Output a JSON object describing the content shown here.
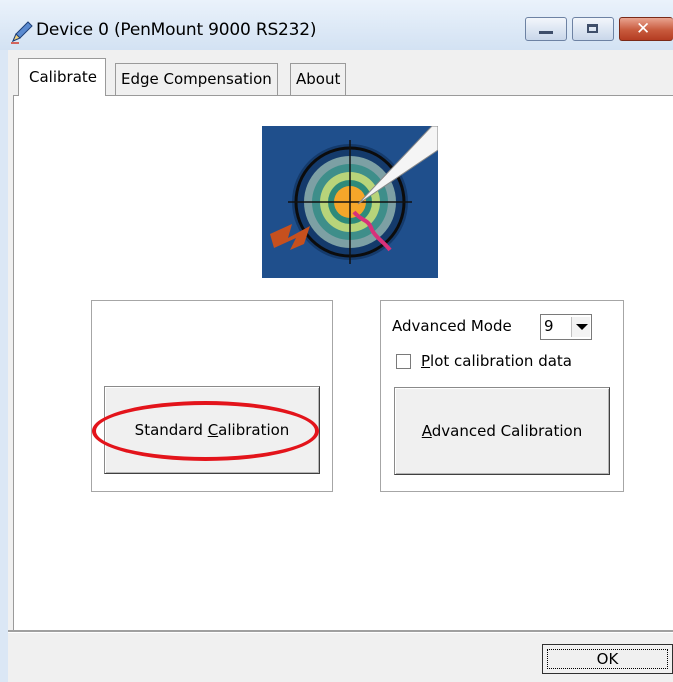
{
  "window": {
    "title": "Device 0 (PenMount 9000 RS232)",
    "close_glyph": "✕",
    "controls": [
      "minimize-icon",
      "maximize-icon",
      "close-icon"
    ]
  },
  "tabs": [
    {
      "label": "Calibrate",
      "selected": true
    },
    {
      "label": "Edge Compensation",
      "selected": false
    },
    {
      "label": "About",
      "selected": false
    }
  ],
  "standard": {
    "button_prefix": "Standard ",
    "button_mnemonic": "C",
    "button_rest": "alibration"
  },
  "advanced": {
    "mode_label": "Advanced Mode",
    "mode_value": "9",
    "plot_mnemonic": "P",
    "plot_rest": "lot calibration data",
    "plot_checked": false,
    "button_mnemonic": "A",
    "button_rest": "dvanced Calibration"
  },
  "footer": {
    "ok_label": "OK"
  },
  "colors": {
    "highlight": "#e3141b",
    "art_background": "#1f4f8c"
  }
}
